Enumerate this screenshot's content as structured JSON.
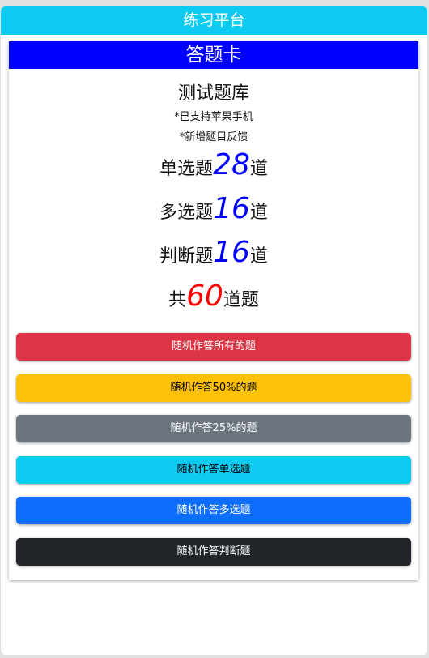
{
  "app_title": "练习平台",
  "card": {
    "header": "答题卡",
    "bank_title": "测试题库",
    "notes": [
      "*已支持苹果手机",
      "*新增题目反馈"
    ],
    "stats": [
      {
        "prefix": "单选题",
        "count": "28",
        "suffix": "道"
      },
      {
        "prefix": "多选题",
        "count": "16",
        "suffix": "道"
      },
      {
        "prefix": "判断题",
        "count": "16",
        "suffix": "道"
      }
    ],
    "total": {
      "prefix": "共",
      "count": "60",
      "suffix": "道题"
    }
  },
  "buttons": [
    {
      "label": "随机作答所有的题",
      "bg": "#dc3545",
      "fg": "#ffffff"
    },
    {
      "label": "随机作答50%的题",
      "bg": "#ffc107",
      "fg": "#000000"
    },
    {
      "label": "随机作答25%的题",
      "bg": "#6c757d",
      "fg": "#ffffff"
    },
    {
      "label": "随机作答单选题",
      "bg": "#0dcaf0",
      "fg": "#000000"
    },
    {
      "label": "随机作答多选题",
      "bg": "#0d6efd",
      "fg": "#ffffff"
    },
    {
      "label": "随机作答判断题",
      "bg": "#212529",
      "fg": "#ffffff"
    }
  ]
}
